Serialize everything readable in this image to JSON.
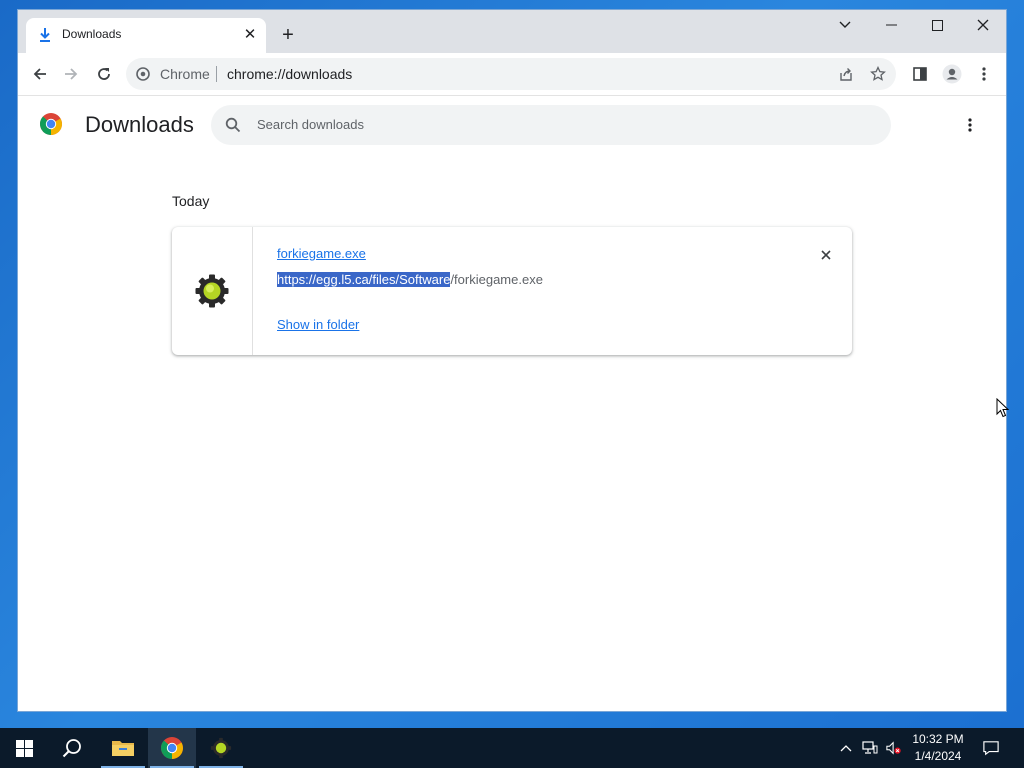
{
  "browser": {
    "tab": {
      "title": "Downloads",
      "icon": "download-icon"
    },
    "window_controls": [
      "tab-search",
      "minimize",
      "maximize",
      "close"
    ],
    "omnibox": {
      "chip": "Chrome",
      "url": "chrome://downloads"
    }
  },
  "downloads_page": {
    "title": "Downloads",
    "search": {
      "placeholder": "Search downloads"
    },
    "sections": [
      {
        "date": "Today",
        "items": [
          {
            "file_name": "forkiegame.exe",
            "url_selected": "https://egg.l5.ca/files/Software",
            "url_rest": "/forkiegame.exe",
            "action": "Show in folder"
          }
        ]
      }
    ]
  },
  "taskbar": {
    "apps": [
      "start",
      "search",
      "file-explorer",
      "chrome",
      "forkiegame"
    ],
    "clock": {
      "time": "10:32 PM",
      "date": "1/4/2024"
    }
  },
  "colors": {
    "accent": "#1a73e8",
    "selection": "#3a67c8",
    "desktop": "#1a6ac7",
    "taskbar": "#0b1a2a"
  }
}
